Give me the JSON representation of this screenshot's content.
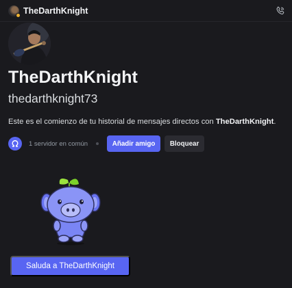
{
  "header": {
    "name": "TheDarthKnight",
    "avatar_icon": "user-avatar-icon",
    "call_icon": "phone-call-icon"
  },
  "profile": {
    "display_name": "TheDarthKnight",
    "username": "thedarthknight73",
    "intro_prefix": "Este es el comienzo de tu historial de mensajes directos con ",
    "intro_name": "TheDarthKnight",
    "intro_suffix": "."
  },
  "meta": {
    "mutual_servers": "1 servidor en común",
    "add_friend": "Añadir amigo",
    "block": "Bloquear"
  },
  "wave_button": "Saluda a TheDarthKnight",
  "colors": {
    "accent": "#5865f2",
    "background": "#1a1a1e",
    "status": "#f0b232"
  }
}
